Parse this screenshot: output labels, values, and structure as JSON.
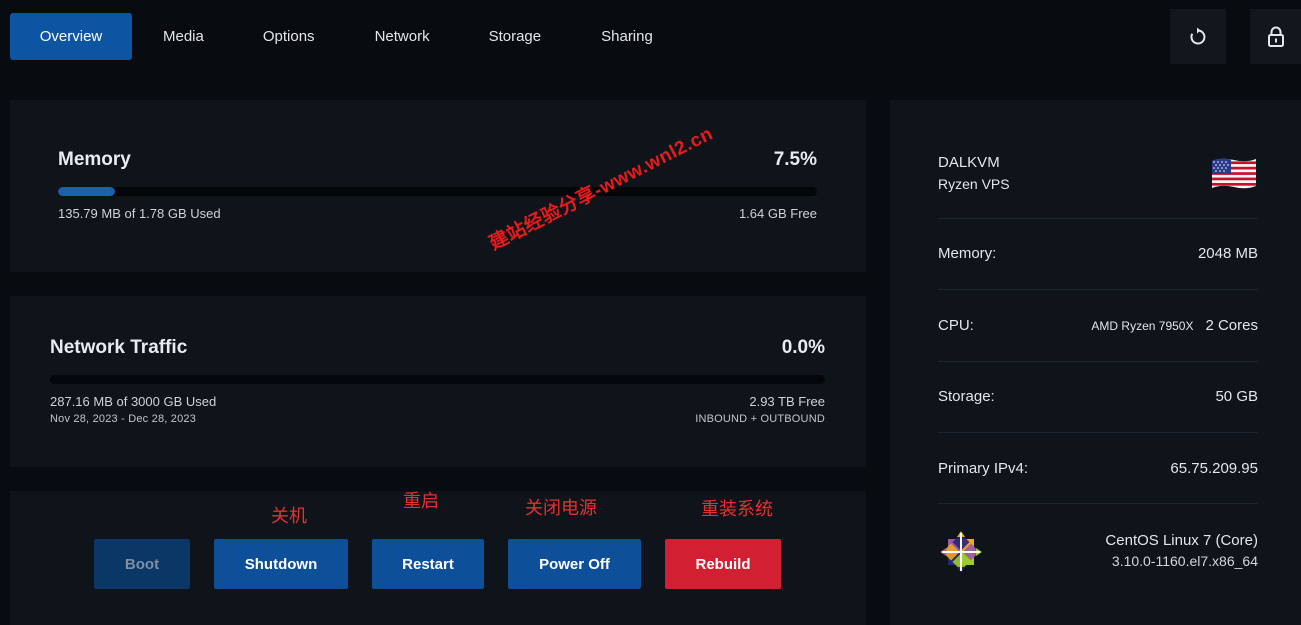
{
  "tabs": [
    {
      "label": "Overview",
      "active": true
    },
    {
      "label": "Media"
    },
    {
      "label": "Options"
    },
    {
      "label": "Network"
    },
    {
      "label": "Storage"
    },
    {
      "label": "Sharing"
    }
  ],
  "toolbar": {
    "refresh_icon": "refresh-icon",
    "lock_icon": "lock-icon"
  },
  "memory": {
    "title": "Memory",
    "percent_text": "7.5%",
    "percent": 7.5,
    "used": "135.79 MB of 1.78 GB Used",
    "free": "1.64 GB Free"
  },
  "network": {
    "title": "Network Traffic",
    "percent_text": "0.0%",
    "percent": 0.0,
    "used": "287.16 MB of 3000 GB Used",
    "period": "Nov 28, 2023 - Dec 28, 2023",
    "free": "2.93 TB Free",
    "direction": "INBOUND + OUTBOUND"
  },
  "actions": {
    "boot": "Boot",
    "shutdown": "Shutdown",
    "restart": "Restart",
    "power_off": "Power Off",
    "rebuild": "Rebuild"
  },
  "annotations": {
    "shutdown": "关机",
    "restart": "重启",
    "power_off": "关闭电源",
    "rebuild": "重装系统"
  },
  "watermark": "建站经验分享-www.wnl2.cn",
  "server": {
    "name": "DALKVM",
    "plan": "Ryzen VPS",
    "flag_icon": "us-flag-icon",
    "memory_label": "Memory:",
    "memory_value": "2048 MB",
    "cpu_label": "CPU:",
    "cpu_model": "AMD Ryzen 7950X",
    "cpu_cores": "2 Cores",
    "storage_label": "Storage:",
    "storage_value": "50 GB",
    "ipv4_label": "Primary IPv4:",
    "ipv4_value": "65.75.209.95",
    "os_icon": "centos-logo-icon",
    "os_name": "CentOS Linux 7 (Core)",
    "os_kernel": "3.10.0-1160.el7.x86_64"
  },
  "colors": {
    "accent": "#0d55a3",
    "button_blue": "#0d4f99",
    "danger": "#d31f32",
    "annotation": "#e8302f"
  }
}
